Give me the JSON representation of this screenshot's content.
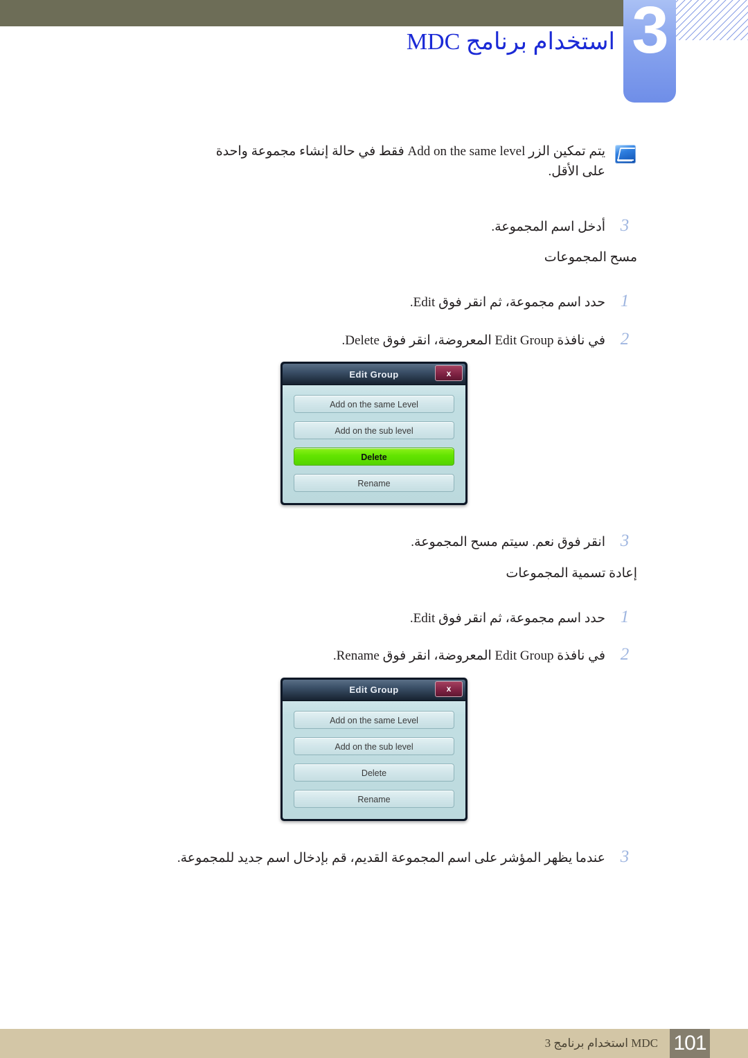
{
  "chapter": {
    "number": "3",
    "title": "استخدام برنامج MDC"
  },
  "note": {
    "icon": "note-pen-icon",
    "text": "يتم تمكين الزر Add on the same level فقط في حالة إنشاء مجموعة واحدة على الأقل."
  },
  "body": {
    "step_enter_group_name": {
      "marker": "3",
      "text": "أدخل اسم المجموعة."
    },
    "section_delete_groups": "مسح المجموعات",
    "delete_steps": [
      {
        "marker": "1",
        "text": "حدد اسم مجموعة، ثم انقر فوق Edit."
      },
      {
        "marker": "2",
        "text": "في نافذة Edit Group المعروضة، انقر فوق Delete."
      }
    ],
    "step_confirm_delete": {
      "marker": "3",
      "text": "انقر فوق نعم. سيتم مسح المجموعة."
    },
    "section_rename_groups": "إعادة تسمية المجموعات",
    "rename_steps": [
      {
        "marker": "1",
        "text": "حدد اسم مجموعة، ثم انقر فوق Edit."
      },
      {
        "marker": "2",
        "text": "في نافذة Edit Group المعروضة، انقر فوق Rename."
      }
    ],
    "step_type_new_name": {
      "marker": "3",
      "text": "عندما يظهر المؤشر على اسم المجموعة القديم، قم بإدخال اسم جديد للمجموعة."
    }
  },
  "dialog_delete": {
    "title": "Edit Group",
    "close_label": "x",
    "buttons": [
      {
        "label": "Add on the same Level",
        "selected": false
      },
      {
        "label": "Add on the sub level",
        "selected": false
      },
      {
        "label": "Delete",
        "selected": true
      },
      {
        "label": "Rename",
        "selected": false
      }
    ]
  },
  "dialog_rename": {
    "title": "Edit Group",
    "close_label": "x",
    "buttons": [
      {
        "label": "Add on the same Level",
        "selected": false
      },
      {
        "label": "Add on the sub level",
        "selected": false
      },
      {
        "label": "Delete",
        "selected": false
      },
      {
        "label": "Rename",
        "selected": false
      }
    ]
  },
  "footer": {
    "text": "MDC استخدام برنامج 3",
    "page": "101"
  },
  "colors": {
    "header_bar": "#6d6d57",
    "chapter_tab": "#87a3ee",
    "title_blue": "#1b2ad6",
    "marker_blue": "#9fb6e0",
    "footer_band": "#d3c6a6",
    "footer_page_box": "#857e6d",
    "dialog_selected_green": "#62e400",
    "dialog_close_maroon": "#7d2142"
  }
}
